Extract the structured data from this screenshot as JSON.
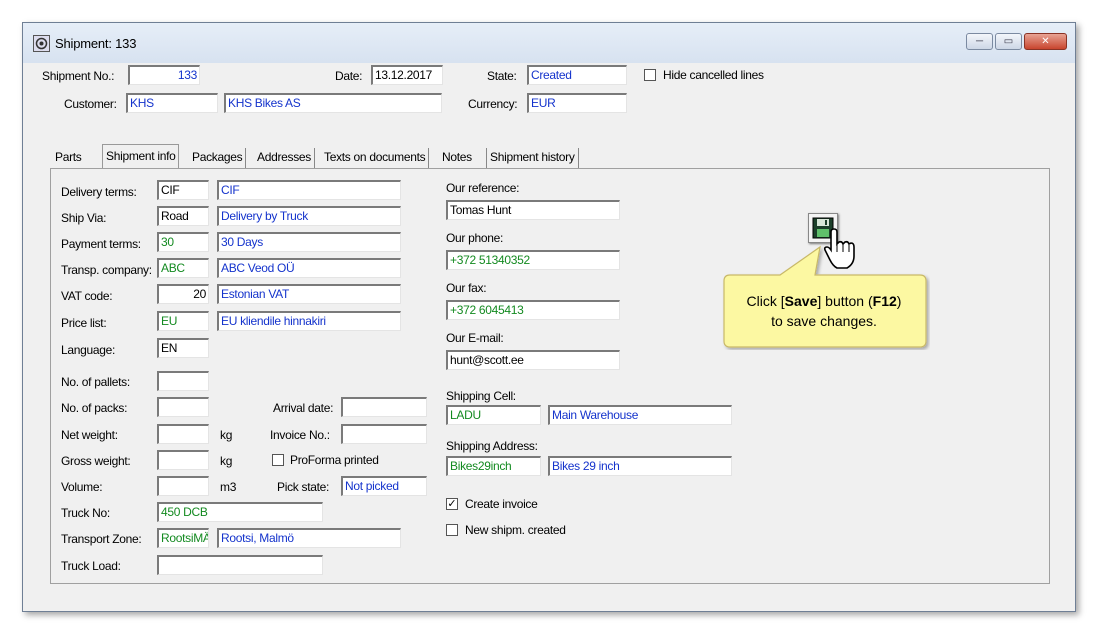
{
  "window": {
    "title": "Shipment: 133",
    "controls": {
      "minimize": "─",
      "maximize": "▭",
      "close": "✕"
    }
  },
  "header": {
    "shipment_no_label": "Shipment No.:",
    "shipment_no": "133",
    "date_label": "Date:",
    "date": "13.12.2017",
    "state_label": "State:",
    "state": "Created",
    "hide_cancelled_label": "Hide cancelled lines",
    "hide_cancelled_checked": false,
    "customer_label": "Customer:",
    "customer_code": "KHS",
    "customer_name": "KHS Bikes AS",
    "currency_label": "Currency:",
    "currency": "EUR"
  },
  "tabs": [
    {
      "label": "Parts"
    },
    {
      "label": "Shipment info"
    },
    {
      "label": "Packages"
    },
    {
      "label": "Addresses"
    },
    {
      "label": "Texts on documents"
    },
    {
      "label": "Notes"
    },
    {
      "label": "Shipment history"
    }
  ],
  "active_tab": "Shipment info",
  "left": {
    "delivery_terms_label": "Delivery terms:",
    "delivery_terms_code": "CIF",
    "delivery_terms_name": "CIF",
    "ship_via_label": "Ship Via:",
    "ship_via_code": "Road",
    "ship_via_name": "Delivery by Truck",
    "payment_terms_label": "Payment terms:",
    "payment_terms_code": "30",
    "payment_terms_name": "30 Days",
    "transp_company_label": "Transp. company:",
    "transp_company_code": "ABC",
    "transp_company_name": "ABC Veod OÜ",
    "vat_code_label": "VAT code:",
    "vat_code": "20",
    "vat_name": "Estonian VAT",
    "price_list_label": "Price list:",
    "price_list_code": "EU",
    "price_list_name": "EU kliendile hinnakiri",
    "language_label": "Language:",
    "language": "EN",
    "no_pallets_label": "No. of pallets:",
    "no_pallets": "",
    "no_packs_label": "No. of packs:",
    "no_packs": "",
    "net_weight_label": "Net weight:",
    "net_weight": "",
    "net_weight_unit": "kg",
    "gross_weight_label": "Gross weight:",
    "gross_weight": "",
    "gross_weight_unit": "kg",
    "volume_label": "Volume:",
    "volume": "",
    "volume_unit": "m3",
    "truck_no_label": "Truck No:",
    "truck_no": "450 DCB",
    "transport_zone_label": "Transport Zone:",
    "transport_zone_code": "RootsiMÄ",
    "transport_zone_name": "Rootsi, Malmö",
    "truck_load_label": "Truck Load:",
    "truck_load": ""
  },
  "middle": {
    "arrival_date_label": "Arrival date:",
    "arrival_date": "",
    "invoice_no_label": "Invoice No.:",
    "invoice_no": "",
    "proforma_label": "ProForma printed",
    "proforma_checked": false,
    "pick_state_label": "Pick state:",
    "pick_state": "Not picked"
  },
  "right": {
    "our_reference_label": "Our reference:",
    "our_reference": "Tomas Hunt",
    "our_phone_label": "Our phone:",
    "our_phone": "+372 51340352",
    "our_fax_label": "Our fax:",
    "our_fax": "+372 6045413",
    "our_email_label": "Our E-mail:",
    "our_email": "hunt@scott.ee",
    "shipping_cell_label": "Shipping Cell:",
    "shipping_cell_code": "LADU",
    "shipping_cell_name": "Main Warehouse",
    "shipping_address_label": "Shipping Address:",
    "shipping_address_code": "Bikes29inch",
    "shipping_address_name": "Bikes 29 inch",
    "create_invoice_label": "Create invoice",
    "create_invoice_checked": true,
    "new_shipm_label": "New shipm. created",
    "new_shipm_checked": false
  },
  "callout": {
    "text_pre": "Click [",
    "text_bold1": "Save",
    "text_mid": "] button (",
    "text_bold2": "F12",
    "text_post": ")",
    "line2": "to save changes.",
    "bg_color": "#fcf8a2",
    "border_color": "#c8b868"
  },
  "checkmark": "✓",
  "colors": {
    "blue_text": "#1433cc",
    "green_text": "#138a20"
  }
}
